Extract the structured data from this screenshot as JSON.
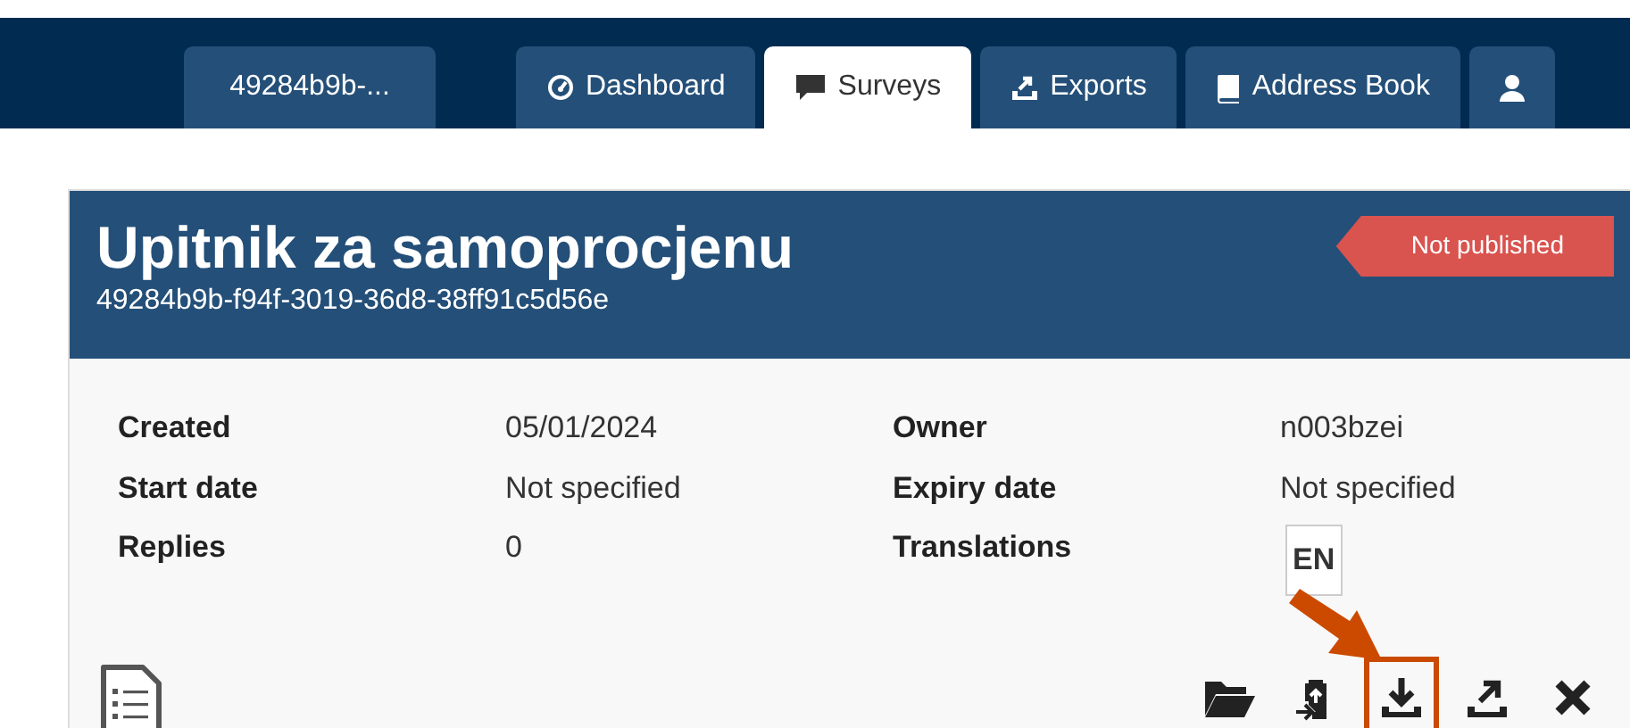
{
  "tabs": [
    {
      "label": "49284b9b-...",
      "kind": "survey",
      "selected": false
    },
    {
      "label": "Dashboard",
      "kind": "dashboard",
      "selected": false
    },
    {
      "label": "Surveys",
      "kind": "surveys",
      "selected": true
    },
    {
      "label": "Exports",
      "kind": "exports",
      "selected": false
    },
    {
      "label": "Address Book",
      "kind": "addressbook",
      "selected": false
    },
    {
      "kind": "users",
      "selected": false
    }
  ],
  "survey": {
    "title": "Upitnik za samoprocjenu",
    "id": "49284b9b-f94f-3019-36d8-38ff91c5d56e",
    "status": "Not published"
  },
  "details": [
    {
      "label": "Created",
      "value": "05/01/2024",
      "kind": "text"
    },
    {
      "label": "Owner",
      "value": "n003bzei",
      "kind": "text"
    },
    {
      "label": "Start date",
      "value": "Not specified",
      "kind": "text"
    },
    {
      "label": "Expiry date",
      "value": "Not specified",
      "kind": "text"
    },
    {
      "label": "Replies",
      "value": "0",
      "kind": "text"
    },
    {
      "label": "Translations",
      "value": "EN",
      "kind": "badge"
    }
  ],
  "actions": [
    {
      "kind": "open",
      "highlighted": false
    },
    {
      "kind": "import",
      "highlighted": false
    },
    {
      "kind": "download",
      "highlighted": true
    },
    {
      "kind": "export",
      "highlighted": false
    },
    {
      "kind": "delete",
      "highlighted": false
    }
  ]
}
